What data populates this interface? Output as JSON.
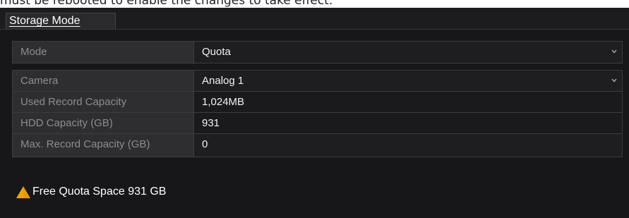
{
  "caption": "must be rebooted to enable the changes to take effect.",
  "tab": {
    "label": "Storage Mode"
  },
  "mode": {
    "label": "Mode",
    "value": "Quota"
  },
  "fields": {
    "camera": {
      "label": "Camera",
      "value": "Analog 1"
    },
    "used_record_capacity": {
      "label": "Used Record Capacity",
      "value": "1,024MB"
    },
    "hdd_capacity": {
      "label": "HDD Capacity (GB)",
      "value": "931"
    },
    "max_record_capacity": {
      "label": "Max. Record Capacity (GB)",
      "value": "0"
    }
  },
  "notice": {
    "icon": "warning-icon",
    "text": "Free Quota Space 931 GB"
  },
  "colors": {
    "panel_bg": "#171719",
    "label_bg": "#2e2e31",
    "warning": "#f0a400"
  }
}
